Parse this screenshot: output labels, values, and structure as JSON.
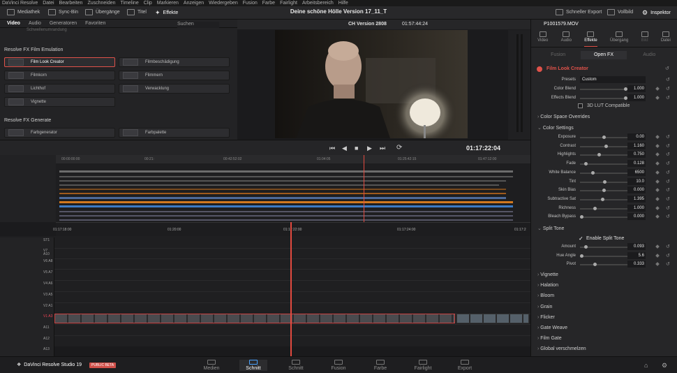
{
  "menu": [
    "DaVinci Resolve",
    "Datei",
    "Bearbeiten",
    "Zuschneiden",
    "Timeline",
    "Clip",
    "Markieren",
    "Anzeigen",
    "Wiedergeben",
    "Fusion",
    "Farbe",
    "Fairlight",
    "Arbeitsbereich",
    "Hilfe"
  ],
  "toolbar": {
    "mediathek": "Mediathek",
    "syncbin": "Sync-Bin",
    "uebergaenge": "Übergänge",
    "titel": "Titel",
    "effekte": "Effekte",
    "title": "Deine schöne Hölle Version 17_11_T",
    "schneller_export": "Schneller Export",
    "vollbild": "Vollbild",
    "inspektor": "Inspektor"
  },
  "effects_panel": {
    "tabs": [
      "Video",
      "Audio",
      "Generatoren",
      "Favoriten"
    ],
    "search": "Suchen",
    "scrolled_item": "Schwellenumrandung",
    "section_film": "Resolve FX Film Emulation",
    "items": [
      "Film Look Creator",
      "Filmbeschädigung",
      "Filmkorn",
      "Flimmern",
      "Lichthof",
      "Verwacklung",
      "Vignette"
    ],
    "section_gen": "Resolve FX Generate",
    "gen_items": [
      "Farbgenerator",
      "Farbpalette"
    ]
  },
  "viewer": {
    "timeline_name": "CH Version 2808",
    "timecode_top": "01:57:44:24",
    "timecode": "01:17:22:04"
  },
  "timeline": {
    "ruler_labels": [
      "01:17:18:00",
      "01:20:00",
      "01:17:22:00",
      "01:17:24:00",
      "01:17:2"
    ],
    "mini_ruler": [
      "00:00:00:00",
      "00:21:",
      "00:42:52:02",
      "01:04:05",
      "01:25:42:15",
      "01:47:12:00"
    ],
    "tracks": [
      "ST1",
      "V7 A10",
      "V6 A8",
      "V5 A7",
      "V4 A6",
      "V3 A5",
      "V2 A1",
      "V1 A3",
      "A11",
      "A12",
      "A13"
    ]
  },
  "inspector": {
    "clip_name": "P1001579.MOV",
    "tabs": [
      "Video",
      "Audio",
      "Effekte",
      "Übergang",
      "Bild",
      "Datei"
    ],
    "subtabs": [
      "Fusion",
      "Open FX",
      "Audio"
    ],
    "effect_name": "Film Look Creator",
    "presets_label": "Presets",
    "presets_value": "Custom",
    "color_blend": {
      "label": "Color Blend",
      "value": "1.000"
    },
    "effects_blend": {
      "label": "Effects Blend",
      "value": "1.000"
    },
    "lut_label": "3D LUT Compatible",
    "groups": {
      "color_space": "Color Space Overrides",
      "color_settings": "Color Settings",
      "split_tone": "Split Tone"
    },
    "color_params": [
      {
        "label": "Exposure",
        "value": "0.00",
        "pos": 0.5
      },
      {
        "label": "Contrast",
        "value": "1.160",
        "pos": 0.55
      },
      {
        "label": "Highlights",
        "value": "0.750",
        "pos": 0.4
      },
      {
        "label": "Fade",
        "value": "0.128",
        "pos": 0.1
      },
      {
        "label": "White Balance",
        "value": "6500",
        "pos": 0.25
      },
      {
        "label": "Tint",
        "value": "10.0",
        "pos": 0.52
      },
      {
        "label": "Skin Bias",
        "value": "0.000",
        "pos": 0.5
      },
      {
        "label": "Subtractive Sat",
        "value": "1.395",
        "pos": 0.48
      },
      {
        "label": "Richness",
        "value": "1.000",
        "pos": 0.3
      },
      {
        "label": "Bleach Bypass",
        "value": "0.000",
        "pos": 0.0
      }
    ],
    "split_enable": "Enable Split Tone",
    "split_params": [
      {
        "label": "Amount",
        "value": "0.093",
        "pos": 0.1
      },
      {
        "label": "Hue Angle",
        "value": "5.6",
        "pos": 0.0
      },
      {
        "label": "Pivot",
        "value": "0.333",
        "pos": 0.3
      }
    ],
    "closed_groups": [
      "Vignette",
      "Halation",
      "Bloom",
      "Grain",
      "Flicker",
      "Gate Weave",
      "Film Gate",
      "Global verschmelzen"
    ]
  },
  "bottombar": {
    "brand": "DaVinci Resolve Studio 19",
    "beta": "PUBLIC BETA",
    "pages": [
      "Medien",
      "Schnitt",
      "Schnitt",
      "Fusion",
      "Farbe",
      "Fairlight",
      "Export"
    ]
  }
}
